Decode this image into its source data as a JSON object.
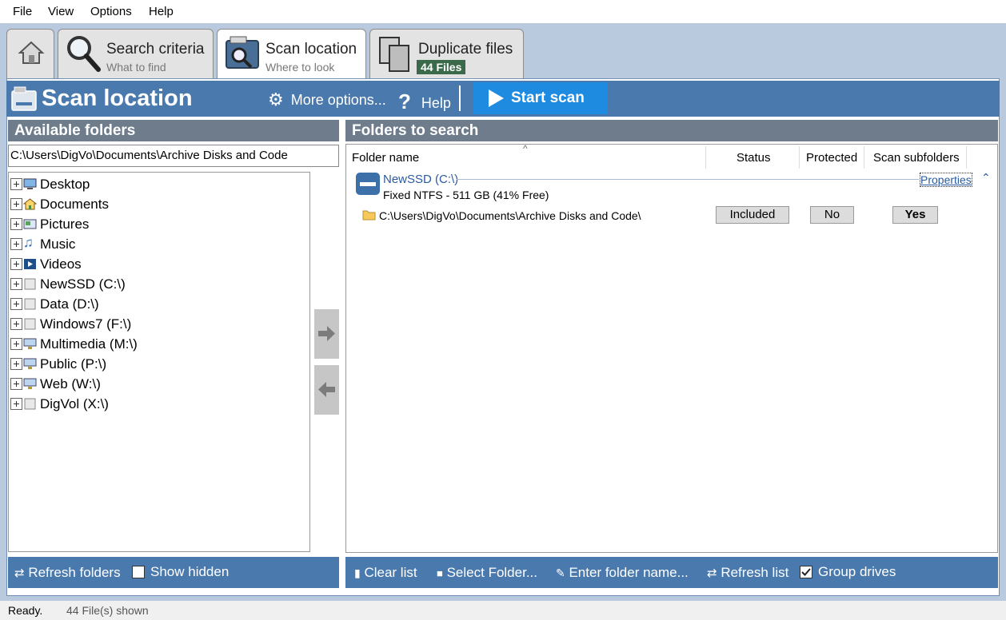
{
  "menu": [
    "File",
    "View",
    "Options",
    "Help"
  ],
  "tabs": [
    {
      "title": "Search criteria",
      "subtitle": "What to find"
    },
    {
      "title": "Scan location",
      "subtitle": "Where to look"
    },
    {
      "title": "Duplicate files",
      "badge": "44 Files"
    }
  ],
  "toolbar": {
    "title": "Scan location",
    "more_options": "More options...",
    "help": "Help",
    "start_scan": "Start scan"
  },
  "left": {
    "header": "Available folders",
    "path": "C:\\Users\\DigVo\\Documents\\Archive Disks and Code",
    "tree": [
      {
        "label": "Desktop",
        "icon": "desktop-icon"
      },
      {
        "label": "Documents",
        "icon": "documents-icon"
      },
      {
        "label": "Pictures",
        "icon": "pictures-icon"
      },
      {
        "label": "Music",
        "icon": "music-icon"
      },
      {
        "label": "Videos",
        "icon": "videos-icon"
      },
      {
        "label": "NewSSD (C:\\)",
        "icon": "drive-icon"
      },
      {
        "label": "Data (D:\\)",
        "icon": "drive-icon"
      },
      {
        "label": "Windows7 (F:\\)",
        "icon": "drive-icon"
      },
      {
        "label": "Multimedia (M:\\)",
        "icon": "network-drive-icon"
      },
      {
        "label": "Public (P:\\)",
        "icon": "network-drive-icon"
      },
      {
        "label": "Web (W:\\)",
        "icon": "network-drive-icon"
      },
      {
        "label": "DigVol (X:\\)",
        "icon": "drive-icon"
      }
    ],
    "refresh": "Refresh folders",
    "show_hidden": "Show hidden"
  },
  "right": {
    "header": "Folders to search",
    "columns": [
      "Folder name",
      "Status",
      "Protected",
      "Scan subfolders"
    ],
    "drive": {
      "name": "NewSSD (C:\\)",
      "info": "Fixed NTFS - 511 GB (41% Free)",
      "properties": "Properties"
    },
    "rows": [
      {
        "path": "C:\\Users\\DigVo\\Documents\\Archive Disks and Code\\",
        "status": "Included",
        "protected": "No",
        "subfolders": "Yes"
      }
    ],
    "actions": {
      "clear": "Clear list",
      "select": "Select Folder...",
      "enter": "Enter folder name...",
      "refresh": "Refresh list",
      "group": "Group drives"
    }
  },
  "status": {
    "text": "Ready.",
    "count": "44 File(s) shown"
  },
  "colors": {
    "accent": "#4a79ad",
    "header": "#6e7c8c",
    "start": "#1e8ae0"
  }
}
